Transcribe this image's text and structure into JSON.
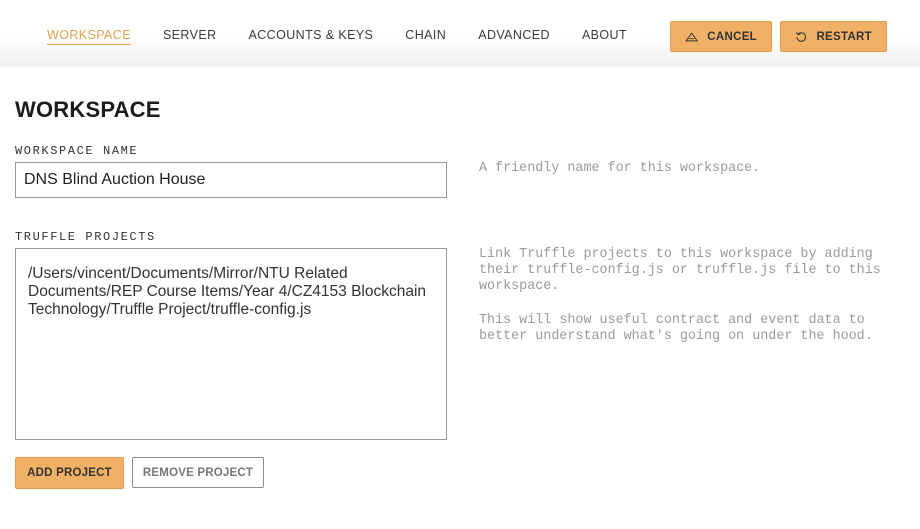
{
  "nav": {
    "items": [
      {
        "label": "WORKSPACE",
        "active": true
      },
      {
        "label": "SERVER",
        "active": false
      },
      {
        "label": "ACCOUNTS & KEYS",
        "active": false
      },
      {
        "label": "CHAIN",
        "active": false
      },
      {
        "label": "ADVANCED",
        "active": false
      },
      {
        "label": "ABOUT",
        "active": false
      }
    ]
  },
  "actions": {
    "cancel": {
      "label": "CANCEL",
      "icon": "warning-triangle-icon"
    },
    "restart": {
      "label": "RESTART",
      "icon": "restart-icon"
    }
  },
  "page": {
    "title": "WORKSPACE"
  },
  "workspace_name": {
    "label": "WORKSPACE NAME",
    "value": "DNS Blind Auction House",
    "help": "A friendly name for this workspace."
  },
  "truffle_projects": {
    "label": "TRUFFLE PROJECTS",
    "paths": [
      "/Users/vincent/Documents/Mirror/NTU Related Documents/REP Course Items/Year 4/CZ4153 Blockchain Technology/Truffle Project/truffle-config.js"
    ],
    "help_1": "Link Truffle projects to this workspace by adding their truffle-config.js or truffle.js file to this workspace.",
    "help_2": "This will show useful contract and event data to better understand what's going on under the hood.",
    "add_label": "ADD PROJECT",
    "remove_label": "REMOVE PROJECT"
  },
  "colors": {
    "accent": "#f0b166",
    "accent_text": "#e0a552",
    "help_text": "#9a9a9a"
  }
}
